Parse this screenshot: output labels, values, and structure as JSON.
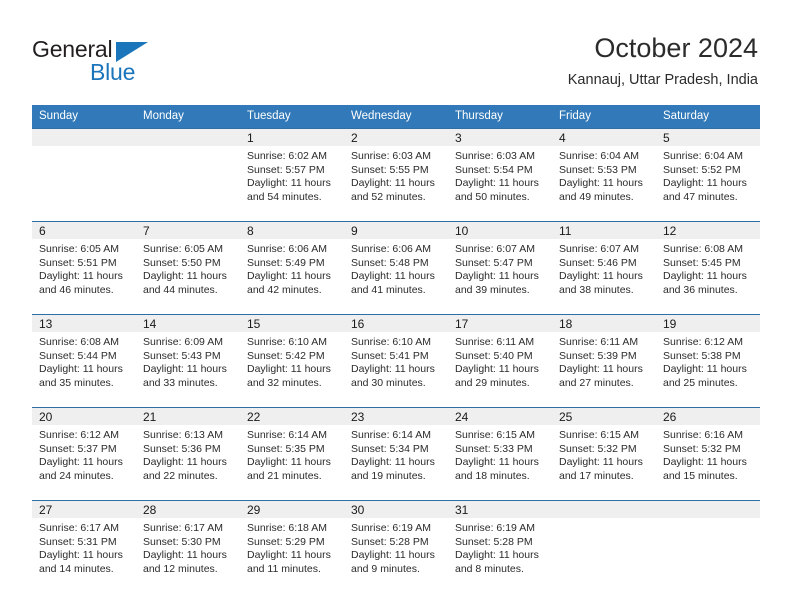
{
  "brand": {
    "name_top": "General",
    "name_bottom": "Blue",
    "accent_color": "#1b75bb"
  },
  "header": {
    "title": "October 2024",
    "subtitle": "Kannauj, Uttar Pradesh, India"
  },
  "theme": {
    "header_row_bg": "#3179b8",
    "row_divider": "#2f6ea5",
    "daynum_band_bg": "#efefef",
    "text": "#2b2b2b"
  },
  "weekday_headers": [
    "Sunday",
    "Monday",
    "Tuesday",
    "Wednesday",
    "Thursday",
    "Friday",
    "Saturday"
  ],
  "weeks": [
    [
      {
        "day": "",
        "sunrise": "",
        "sunset": "",
        "daylight_line1": "",
        "daylight_line2": ""
      },
      {
        "day": "",
        "sunrise": "",
        "sunset": "",
        "daylight_line1": "",
        "daylight_line2": ""
      },
      {
        "day": "1",
        "sunrise": "Sunrise: 6:02 AM",
        "sunset": "Sunset: 5:57 PM",
        "daylight_line1": "Daylight: 11 hours",
        "daylight_line2": "and 54 minutes."
      },
      {
        "day": "2",
        "sunrise": "Sunrise: 6:03 AM",
        "sunset": "Sunset: 5:55 PM",
        "daylight_line1": "Daylight: 11 hours",
        "daylight_line2": "and 52 minutes."
      },
      {
        "day": "3",
        "sunrise": "Sunrise: 6:03 AM",
        "sunset": "Sunset: 5:54 PM",
        "daylight_line1": "Daylight: 11 hours",
        "daylight_line2": "and 50 minutes."
      },
      {
        "day": "4",
        "sunrise": "Sunrise: 6:04 AM",
        "sunset": "Sunset: 5:53 PM",
        "daylight_line1": "Daylight: 11 hours",
        "daylight_line2": "and 49 minutes."
      },
      {
        "day": "5",
        "sunrise": "Sunrise: 6:04 AM",
        "sunset": "Sunset: 5:52 PM",
        "daylight_line1": "Daylight: 11 hours",
        "daylight_line2": "and 47 minutes."
      }
    ],
    [
      {
        "day": "6",
        "sunrise": "Sunrise: 6:05 AM",
        "sunset": "Sunset: 5:51 PM",
        "daylight_line1": "Daylight: 11 hours",
        "daylight_line2": "and 46 minutes."
      },
      {
        "day": "7",
        "sunrise": "Sunrise: 6:05 AM",
        "sunset": "Sunset: 5:50 PM",
        "daylight_line1": "Daylight: 11 hours",
        "daylight_line2": "and 44 minutes."
      },
      {
        "day": "8",
        "sunrise": "Sunrise: 6:06 AM",
        "sunset": "Sunset: 5:49 PM",
        "daylight_line1": "Daylight: 11 hours",
        "daylight_line2": "and 42 minutes."
      },
      {
        "day": "9",
        "sunrise": "Sunrise: 6:06 AM",
        "sunset": "Sunset: 5:48 PM",
        "daylight_line1": "Daylight: 11 hours",
        "daylight_line2": "and 41 minutes."
      },
      {
        "day": "10",
        "sunrise": "Sunrise: 6:07 AM",
        "sunset": "Sunset: 5:47 PM",
        "daylight_line1": "Daylight: 11 hours",
        "daylight_line2": "and 39 minutes."
      },
      {
        "day": "11",
        "sunrise": "Sunrise: 6:07 AM",
        "sunset": "Sunset: 5:46 PM",
        "daylight_line1": "Daylight: 11 hours",
        "daylight_line2": "and 38 minutes."
      },
      {
        "day": "12",
        "sunrise": "Sunrise: 6:08 AM",
        "sunset": "Sunset: 5:45 PM",
        "daylight_line1": "Daylight: 11 hours",
        "daylight_line2": "and 36 minutes."
      }
    ],
    [
      {
        "day": "13",
        "sunrise": "Sunrise: 6:08 AM",
        "sunset": "Sunset: 5:44 PM",
        "daylight_line1": "Daylight: 11 hours",
        "daylight_line2": "and 35 minutes."
      },
      {
        "day": "14",
        "sunrise": "Sunrise: 6:09 AM",
        "sunset": "Sunset: 5:43 PM",
        "daylight_line1": "Daylight: 11 hours",
        "daylight_line2": "and 33 minutes."
      },
      {
        "day": "15",
        "sunrise": "Sunrise: 6:10 AM",
        "sunset": "Sunset: 5:42 PM",
        "daylight_line1": "Daylight: 11 hours",
        "daylight_line2": "and 32 minutes."
      },
      {
        "day": "16",
        "sunrise": "Sunrise: 6:10 AM",
        "sunset": "Sunset: 5:41 PM",
        "daylight_line1": "Daylight: 11 hours",
        "daylight_line2": "and 30 minutes."
      },
      {
        "day": "17",
        "sunrise": "Sunrise: 6:11 AM",
        "sunset": "Sunset: 5:40 PM",
        "daylight_line1": "Daylight: 11 hours",
        "daylight_line2": "and 29 minutes."
      },
      {
        "day": "18",
        "sunrise": "Sunrise: 6:11 AM",
        "sunset": "Sunset: 5:39 PM",
        "daylight_line1": "Daylight: 11 hours",
        "daylight_line2": "and 27 minutes."
      },
      {
        "day": "19",
        "sunrise": "Sunrise: 6:12 AM",
        "sunset": "Sunset: 5:38 PM",
        "daylight_line1": "Daylight: 11 hours",
        "daylight_line2": "and 25 minutes."
      }
    ],
    [
      {
        "day": "20",
        "sunrise": "Sunrise: 6:12 AM",
        "sunset": "Sunset: 5:37 PM",
        "daylight_line1": "Daylight: 11 hours",
        "daylight_line2": "and 24 minutes."
      },
      {
        "day": "21",
        "sunrise": "Sunrise: 6:13 AM",
        "sunset": "Sunset: 5:36 PM",
        "daylight_line1": "Daylight: 11 hours",
        "daylight_line2": "and 22 minutes."
      },
      {
        "day": "22",
        "sunrise": "Sunrise: 6:14 AM",
        "sunset": "Sunset: 5:35 PM",
        "daylight_line1": "Daylight: 11 hours",
        "daylight_line2": "and 21 minutes."
      },
      {
        "day": "23",
        "sunrise": "Sunrise: 6:14 AM",
        "sunset": "Sunset: 5:34 PM",
        "daylight_line1": "Daylight: 11 hours",
        "daylight_line2": "and 19 minutes."
      },
      {
        "day": "24",
        "sunrise": "Sunrise: 6:15 AM",
        "sunset": "Sunset: 5:33 PM",
        "daylight_line1": "Daylight: 11 hours",
        "daylight_line2": "and 18 minutes."
      },
      {
        "day": "25",
        "sunrise": "Sunrise: 6:15 AM",
        "sunset": "Sunset: 5:32 PM",
        "daylight_line1": "Daylight: 11 hours",
        "daylight_line2": "and 17 minutes."
      },
      {
        "day": "26",
        "sunrise": "Sunrise: 6:16 AM",
        "sunset": "Sunset: 5:32 PM",
        "daylight_line1": "Daylight: 11 hours",
        "daylight_line2": "and 15 minutes."
      }
    ],
    [
      {
        "day": "27",
        "sunrise": "Sunrise: 6:17 AM",
        "sunset": "Sunset: 5:31 PM",
        "daylight_line1": "Daylight: 11 hours",
        "daylight_line2": "and 14 minutes."
      },
      {
        "day": "28",
        "sunrise": "Sunrise: 6:17 AM",
        "sunset": "Sunset: 5:30 PM",
        "daylight_line1": "Daylight: 11 hours",
        "daylight_line2": "and 12 minutes."
      },
      {
        "day": "29",
        "sunrise": "Sunrise: 6:18 AM",
        "sunset": "Sunset: 5:29 PM",
        "daylight_line1": "Daylight: 11 hours",
        "daylight_line2": "and 11 minutes."
      },
      {
        "day": "30",
        "sunrise": "Sunrise: 6:19 AM",
        "sunset": "Sunset: 5:28 PM",
        "daylight_line1": "Daylight: 11 hours",
        "daylight_line2": "and 9 minutes."
      },
      {
        "day": "31",
        "sunrise": "Sunrise: 6:19 AM",
        "sunset": "Sunset: 5:28 PM",
        "daylight_line1": "Daylight: 11 hours",
        "daylight_line2": "and 8 minutes."
      },
      {
        "day": "",
        "sunrise": "",
        "sunset": "",
        "daylight_line1": "",
        "daylight_line2": ""
      },
      {
        "day": "",
        "sunrise": "",
        "sunset": "",
        "daylight_line1": "",
        "daylight_line2": ""
      }
    ]
  ]
}
